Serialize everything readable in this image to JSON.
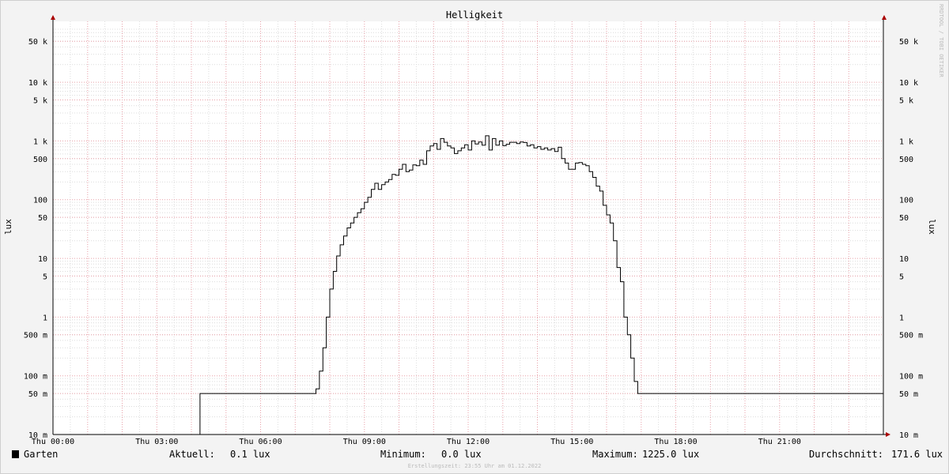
{
  "chart_data": {
    "type": "line",
    "title": "Helligkeit",
    "ylabel": "lux",
    "yscale": "log",
    "ylim": [
      0.01,
      80000
    ],
    "xlim": [
      0,
      24
    ],
    "x_ticks": [
      {
        "t": 0,
        "label": "Thu 00:00"
      },
      {
        "t": 3,
        "label": "Thu 03:00"
      },
      {
        "t": 6,
        "label": "Thu 06:00"
      },
      {
        "t": 9,
        "label": "Thu 09:00"
      },
      {
        "t": 12,
        "label": "Thu 12:00"
      },
      {
        "t": 15,
        "label": "Thu 15:00"
      },
      {
        "t": 18,
        "label": "Thu 18:00"
      },
      {
        "t": 21,
        "label": "Thu 21:00"
      }
    ],
    "y_ticks": [
      {
        "v": 50000,
        "label": "50 k"
      },
      {
        "v": 10000,
        "label": "10 k"
      },
      {
        "v": 5000,
        "label": "5 k"
      },
      {
        "v": 1000,
        "label": "1 k"
      },
      {
        "v": 500,
        "label": "500"
      },
      {
        "v": 100,
        "label": "100"
      },
      {
        "v": 50,
        "label": "50"
      },
      {
        "v": 10,
        "label": "10"
      },
      {
        "v": 5,
        "label": "5"
      },
      {
        "v": 1,
        "label": "1"
      },
      {
        "v": 0.5,
        "label": "500 m"
      },
      {
        "v": 0.1,
        "label": "100 m"
      },
      {
        "v": 0.05,
        "label": "50 m"
      },
      {
        "v": 0.01,
        "label": "10 m"
      }
    ],
    "grid": true,
    "series": [
      {
        "name": "Garten",
        "color": "#000000",
        "step": true,
        "points": [
          [
            0.0,
            0.01
          ],
          [
            4.25,
            0.05
          ],
          [
            7.6,
            0.06
          ],
          [
            7.7,
            0.12
          ],
          [
            7.8,
            0.3
          ],
          [
            7.9,
            1.0
          ],
          [
            8.0,
            3.0
          ],
          [
            8.1,
            6.0
          ],
          [
            8.2,
            11
          ],
          [
            8.3,
            17
          ],
          [
            8.4,
            24
          ],
          [
            8.5,
            33
          ],
          [
            8.6,
            40
          ],
          [
            8.7,
            50
          ],
          [
            8.8,
            60
          ],
          [
            8.9,
            70
          ],
          [
            9.0,
            90
          ],
          [
            9.1,
            110
          ],
          [
            9.2,
            150
          ],
          [
            9.3,
            190
          ],
          [
            9.4,
            150
          ],
          [
            9.5,
            180
          ],
          [
            9.6,
            200
          ],
          [
            9.7,
            220
          ],
          [
            9.8,
            270
          ],
          [
            9.9,
            260
          ],
          [
            10.0,
            330
          ],
          [
            10.1,
            400
          ],
          [
            10.2,
            300
          ],
          [
            10.3,
            320
          ],
          [
            10.4,
            390
          ],
          [
            10.5,
            380
          ],
          [
            10.6,
            470
          ],
          [
            10.7,
            400
          ],
          [
            10.8,
            680
          ],
          [
            10.9,
            820
          ],
          [
            11.0,
            900
          ],
          [
            11.1,
            720
          ],
          [
            11.2,
            1100
          ],
          [
            11.3,
            950
          ],
          [
            11.4,
            820
          ],
          [
            11.5,
            760
          ],
          [
            11.6,
            610
          ],
          [
            11.7,
            680
          ],
          [
            11.8,
            760
          ],
          [
            11.9,
            860
          ],
          [
            12.0,
            700
          ],
          [
            12.1,
            1000
          ],
          [
            12.2,
            890
          ],
          [
            12.3,
            960
          ],
          [
            12.4,
            850
          ],
          [
            12.5,
            1225
          ],
          [
            12.6,
            700
          ],
          [
            12.7,
            1100
          ],
          [
            12.8,
            850
          ],
          [
            12.9,
            1000
          ],
          [
            13.0,
            830
          ],
          [
            13.1,
            880
          ],
          [
            13.2,
            950
          ],
          [
            13.3,
            950
          ],
          [
            13.4,
            900
          ],
          [
            13.5,
            960
          ],
          [
            13.6,
            940
          ],
          [
            13.7,
            820
          ],
          [
            13.8,
            860
          ],
          [
            13.9,
            760
          ],
          [
            14.0,
            800
          ],
          [
            14.1,
            720
          ],
          [
            14.2,
            760
          ],
          [
            14.3,
            700
          ],
          [
            14.4,
            740
          ],
          [
            14.5,
            660
          ],
          [
            14.6,
            780
          ],
          [
            14.7,
            500
          ],
          [
            14.8,
            420
          ],
          [
            14.9,
            330
          ],
          [
            15.0,
            330
          ],
          [
            15.1,
            420
          ],
          [
            15.2,
            430
          ],
          [
            15.3,
            400
          ],
          [
            15.4,
            380
          ],
          [
            15.5,
            300
          ],
          [
            15.6,
            240
          ],
          [
            15.7,
            170
          ],
          [
            15.8,
            140
          ],
          [
            15.9,
            80
          ],
          [
            16.0,
            55
          ],
          [
            16.1,
            40
          ],
          [
            16.2,
            20
          ],
          [
            16.3,
            7
          ],
          [
            16.4,
            4
          ],
          [
            16.5,
            1.0
          ],
          [
            16.6,
            0.5
          ],
          [
            16.7,
            0.2
          ],
          [
            16.8,
            0.08
          ],
          [
            16.9,
            0.05
          ],
          [
            24.0,
            0.05
          ]
        ]
      }
    ]
  },
  "legend": {
    "series_name": "Garten",
    "series_color": "#000000",
    "current_label": "Aktuell:",
    "current_value": "0.1 lux",
    "min_label": "Minimum:",
    "min_value": "0.0 lux",
    "max_label": "Maximum:",
    "max_value": "1225.0 lux",
    "avg_label": "Durchschnitt:",
    "avg_value": "171.6 lux"
  },
  "credit": "RRDTOOL / TOBI OETIKER",
  "footer": "Erstellungszeit: 23:55 Uhr am 01.12.2022"
}
